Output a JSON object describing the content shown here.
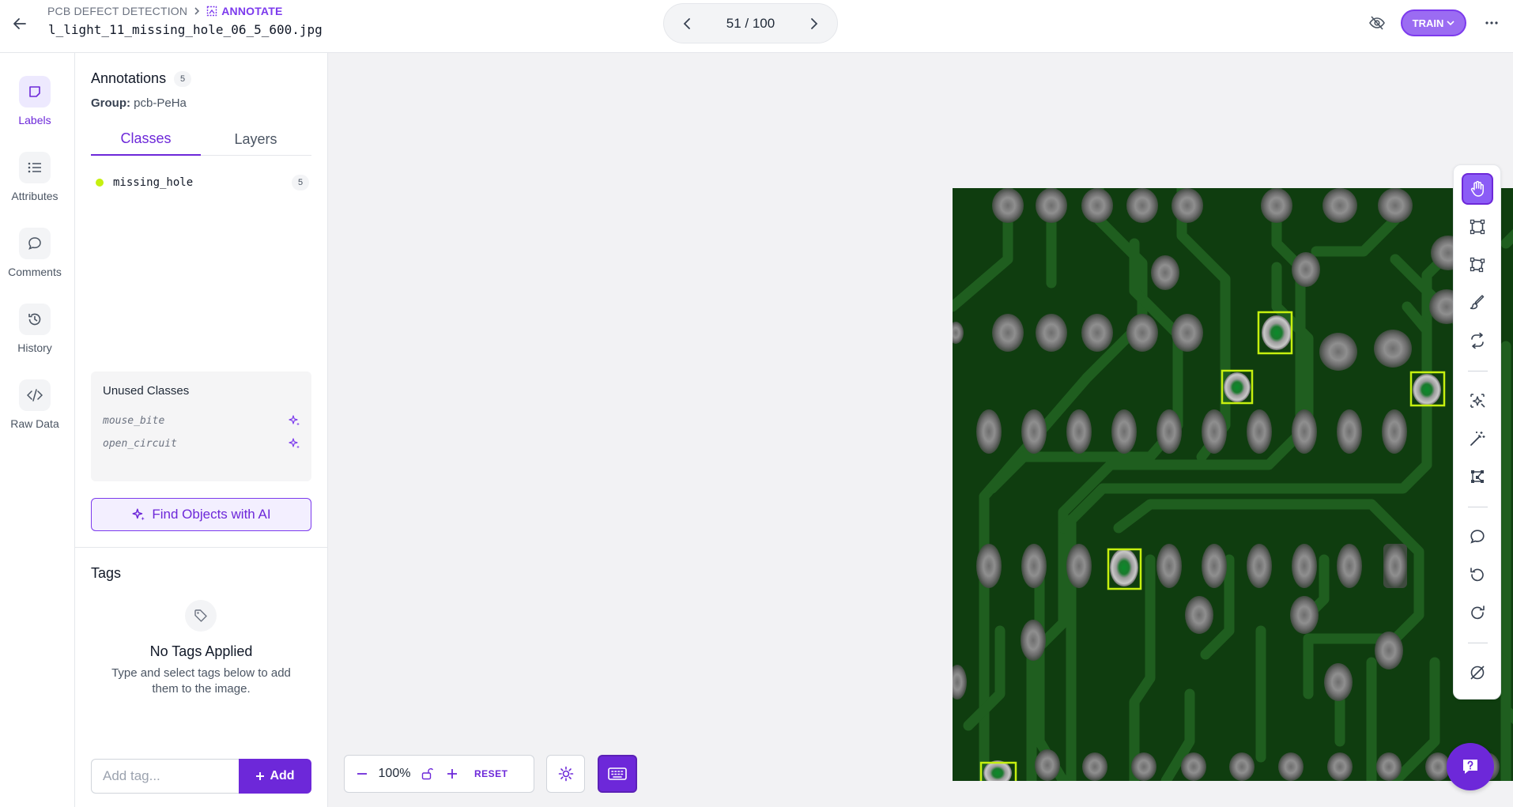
{
  "header": {
    "breadcrumb_project": "PCB DEFECT DETECTION",
    "breadcrumb_current": "ANNOTATE",
    "filename": "l_light_11_missing_hole_06_5_600.jpg",
    "pager_text": "51 / 100",
    "train_label": "TRAIN"
  },
  "rail": {
    "items": [
      {
        "label": "Labels",
        "icon": "label-icon",
        "active": true
      },
      {
        "label": "Attributes",
        "icon": "list-icon"
      },
      {
        "label": "Comments",
        "icon": "comment-icon"
      },
      {
        "label": "History",
        "icon": "history-icon"
      },
      {
        "label": "Raw Data",
        "icon": "code-icon"
      }
    ]
  },
  "panel": {
    "title": "Annotations",
    "count": "5",
    "group_label": "Group:",
    "group_value": "pcb-PeHa",
    "tabs": [
      "Classes",
      "Layers"
    ],
    "classes": [
      {
        "name": "missing_hole",
        "count": "5",
        "color": "#c6f00f"
      }
    ],
    "unused_title": "Unused Classes",
    "unused": [
      "mouse_bite",
      "open_circuit"
    ],
    "ai_button": "Find Objects with AI",
    "tags_title": "Tags",
    "no_tags_title": "No Tags Applied",
    "no_tags_sub": "Type and select tags below to add them to the image.",
    "tag_placeholder": "Add tag...",
    "add_label": "Add"
  },
  "canvas": {
    "zoom": "100%",
    "reset_label": "RESET",
    "accent": "#6d28d9",
    "annotation_color": "#c6f00f"
  }
}
